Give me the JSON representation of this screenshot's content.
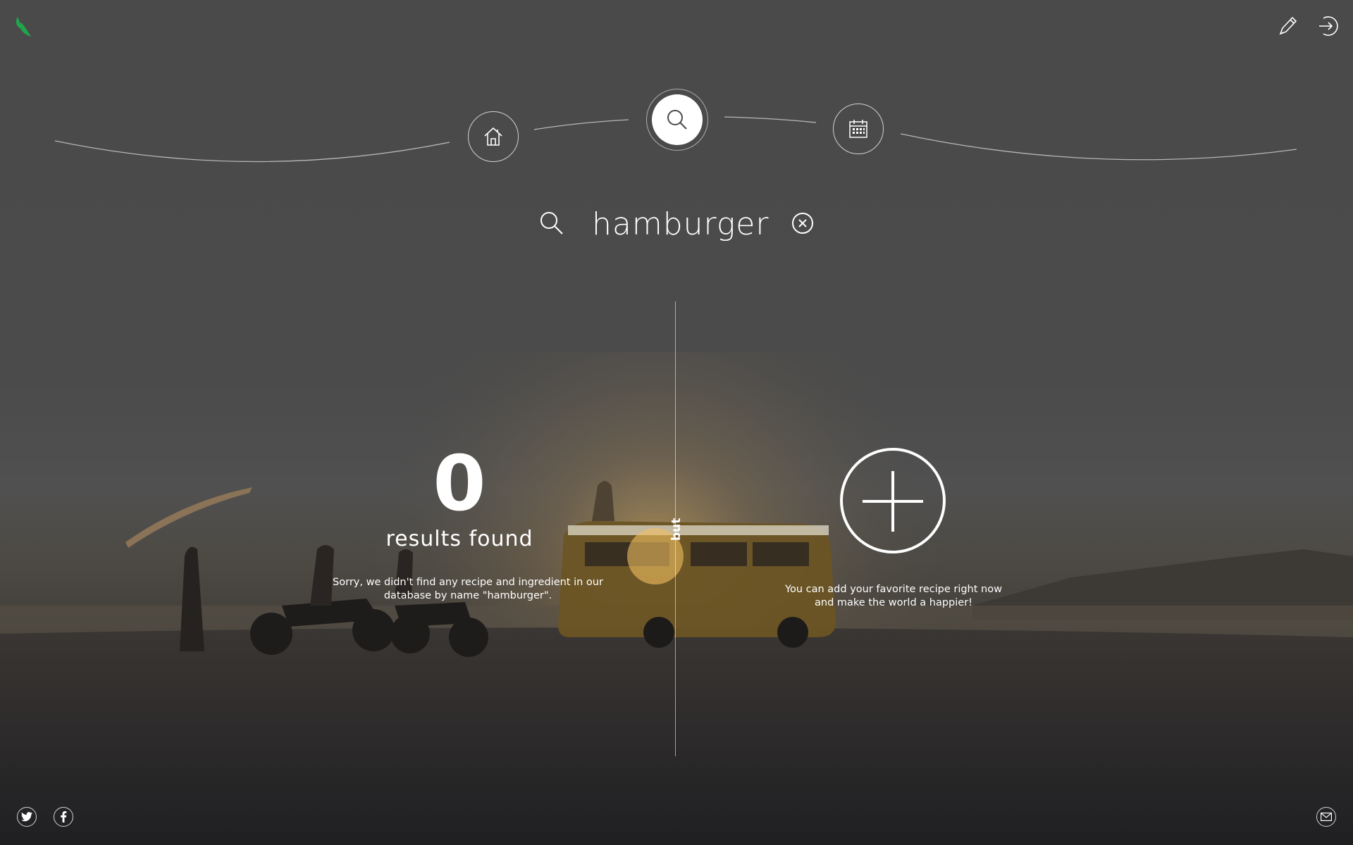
{
  "header": {
    "logo_icon": "leaf-logo-icon",
    "actions": [
      {
        "icon": "pencil-icon"
      },
      {
        "icon": "sign-out-icon"
      }
    ]
  },
  "nav": {
    "items": [
      {
        "icon": "home-icon",
        "active": false
      },
      {
        "icon": "search-icon",
        "active": true
      },
      {
        "icon": "calendar-icon",
        "active": false
      }
    ]
  },
  "search": {
    "value": "hamburger",
    "icon": "search-icon",
    "clear_icon": "close-circle-icon"
  },
  "results": {
    "count": "0",
    "count_label": "results found",
    "message": "Sorry, we didn't find any recipe and ingredient in our database by name \"hamburger\"."
  },
  "divider": {
    "label": "but"
  },
  "add_recipe": {
    "icon": "plus-icon",
    "message_line1": "You can add your favorite recipe right now",
    "message_line2": "and make the world a happier!"
  },
  "footer": {
    "social": [
      {
        "icon": "twitter-icon"
      },
      {
        "icon": "facebook-icon"
      }
    ],
    "contact_icon": "mail-icon"
  },
  "colors": {
    "logo": "#1fa64a",
    "text": "#ffffff"
  }
}
